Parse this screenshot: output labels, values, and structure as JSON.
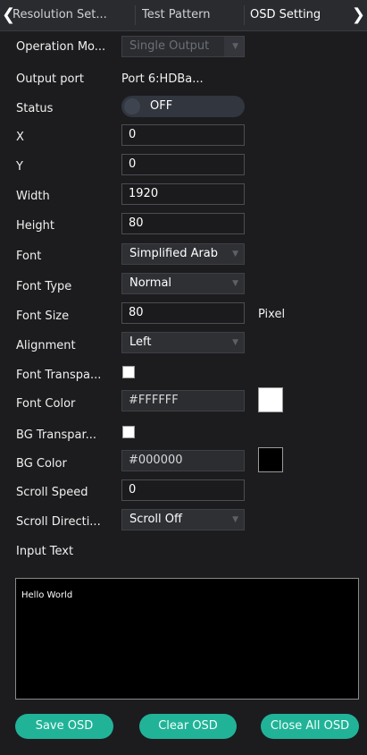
{
  "tabs": {
    "prev_arrow": "❮",
    "next_arrow": "❯",
    "items": [
      {
        "label": "Resolution Set..."
      },
      {
        "label": "Test Pattern"
      },
      {
        "label": "OSD Setting"
      }
    ],
    "active_index": 2
  },
  "form": {
    "operation_mode": {
      "label": "Operation Mo...",
      "value": "Single Output",
      "disabled": true
    },
    "output_port": {
      "label": "Output port",
      "value": "Port 6:HDBa..."
    },
    "status": {
      "label": "Status",
      "value": "OFF"
    },
    "x": {
      "label": "X",
      "value": "0"
    },
    "y": {
      "label": "Y",
      "value": "0"
    },
    "width": {
      "label": "Width",
      "value": "1920"
    },
    "height": {
      "label": "Height",
      "value": "80"
    },
    "font": {
      "label": "Font",
      "value": "Simplified Arab"
    },
    "font_type": {
      "label": "Font Type",
      "value": "Normal"
    },
    "font_size": {
      "label": "Font Size",
      "value": "80",
      "unit": "Pixel"
    },
    "alignment": {
      "label": "Alignment",
      "value": "Left"
    },
    "font_transparency": {
      "label": "Font Transpa...",
      "checked": false
    },
    "font_color": {
      "label": "Font Color",
      "value": "#FFFFFF",
      "swatch": "#ffffff"
    },
    "bg_transparency": {
      "label": "BG Transpar...",
      "checked": false
    },
    "bg_color": {
      "label": "BG Color",
      "value": "#000000",
      "swatch": "#000000"
    },
    "scroll_speed": {
      "label": "Scroll Speed",
      "value": "0"
    },
    "scroll_direction": {
      "label": "Scroll Directi...",
      "value": "Scroll Off"
    },
    "input_text": {
      "label": "Input Text",
      "value": "Hello World"
    }
  },
  "buttons": {
    "save": "Save OSD",
    "clear": "Clear OSD",
    "close_all": "Close All OSD"
  },
  "colors": {
    "panel_bg": "#1c1c1e",
    "accent": "#21b398"
  }
}
